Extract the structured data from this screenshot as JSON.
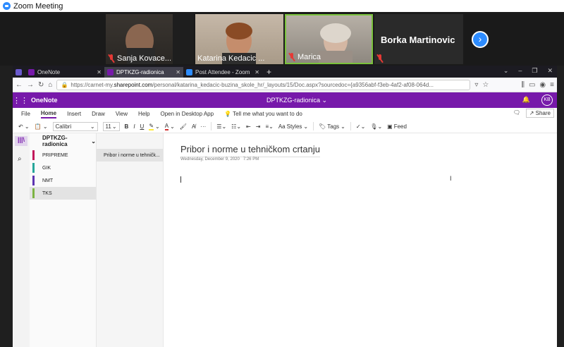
{
  "zoom": {
    "window_title": "Zoom Meeting",
    "participants": [
      {
        "name": "Sanja Kovace..."
      },
      {
        "name": "Katarina Kedacic ..."
      },
      {
        "name": "Marica"
      }
    ],
    "featured_name": "Borka Martinovic",
    "next_icon": "chevron-right-icon"
  },
  "browser": {
    "tabs": [
      {
        "label": "OneNote",
        "color": "#7719aa",
        "active": false
      },
      {
        "label": "DPTKZG-radionica",
        "color": "#7719aa",
        "active": true
      },
      {
        "label": "Post Attendee - Zoom",
        "color": "#2d8cff",
        "active": false
      }
    ],
    "url_prefix": "https://carnet-my.",
    "url_domain": "sharepoint.com",
    "url_rest": "/personal/katarina_kedacic-buzina_skole_hr/_layouts/15/Doc.aspx?sourcedoc={a9356abf-f3eb-4af2-af08-064d..."
  },
  "onenote": {
    "app_name": "OneNote",
    "doc_title": "DPTKZG-radionica",
    "avatar": "KB",
    "menu": [
      "File",
      "Home",
      "Insert",
      "Draw",
      "View",
      "Help",
      "Open in Desktop App"
    ],
    "tell_me": "Tell me what you want to do",
    "share_label": "Share",
    "font_name": "Calibri",
    "font_size": "11",
    "styles_label": "Styles",
    "tags_label": "Tags",
    "feed_label": "Feed",
    "notebook_name": "DPTKZG-radionica",
    "sections": [
      {
        "label": "PRIPREME",
        "color": "#c2185b"
      },
      {
        "label": "GIK",
        "color": "#26a69a"
      },
      {
        "label": "NMT",
        "color": "#5e35b1"
      },
      {
        "label": "TKS",
        "color": "#7cb342"
      }
    ],
    "page_label": "Pribor i norme u tehničk...",
    "page_title": "Pribor i norme u tehničkom crtanju",
    "page_date": "Wednesday, December 9, 2020",
    "page_time": "7:26 PM"
  }
}
